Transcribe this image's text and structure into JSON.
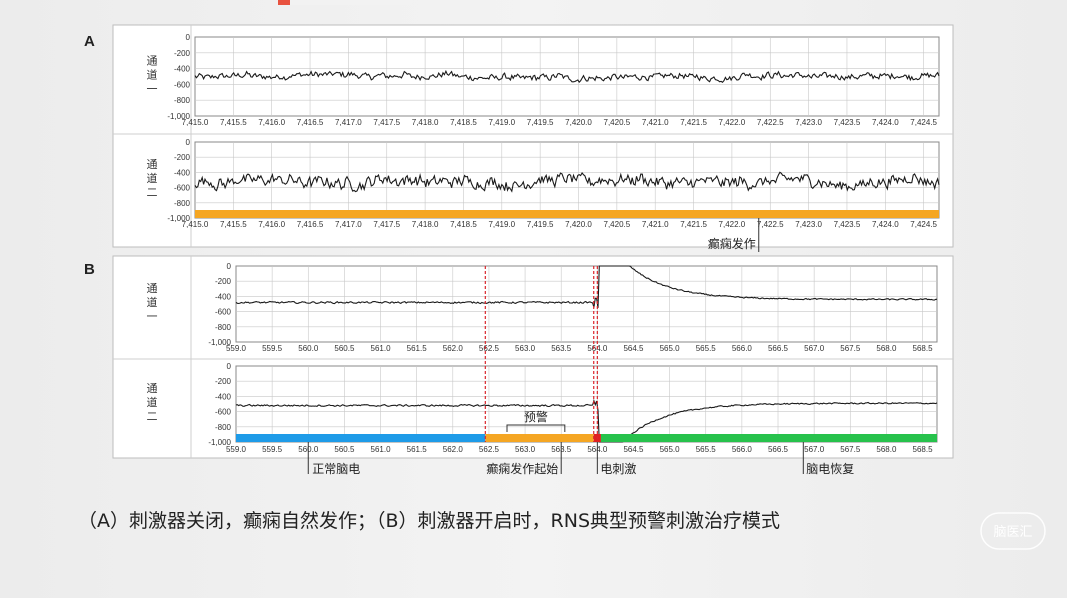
{
  "panels": {
    "A": {
      "letter": "A",
      "channels": [
        {
          "label_lines": [
            "通",
            "道",
            "一"
          ]
        },
        {
          "label_lines": [
            "通",
            "道",
            "二"
          ]
        }
      ],
      "y_ticks": [
        "0",
        "-200",
        "-400",
        "-600",
        "-800",
        "-1,000"
      ],
      "x_ticks": [
        "7,415.0",
        "7,415.5",
        "7,416.0",
        "7,416.5",
        "7,417.0",
        "7,417.5",
        "7,418.0",
        "7,418.5",
        "7,419.0",
        "7,419.5",
        "7,420.0",
        "7,420.5",
        "7,421.0",
        "7,421.5",
        "7,422.0",
        "7,422.5",
        "7,423.0",
        "7,423.5",
        "7,424.0",
        "7,424.5"
      ],
      "annotations": {
        "seizure": "癫痫发作"
      }
    },
    "B": {
      "letter": "B",
      "channels": [
        {
          "label_lines": [
            "通",
            "道",
            "一"
          ]
        },
        {
          "label_lines": [
            "通",
            "道",
            "二"
          ]
        }
      ],
      "y_ticks": [
        "0",
        "-200",
        "-400",
        "-600",
        "-800",
        "-1,000"
      ],
      "x_ticks": [
        "559.0",
        "559.5",
        "560.0",
        "560.5",
        "561.0",
        "561.5",
        "562.0",
        "562.5",
        "563.0",
        "563.5",
        "564.0",
        "564.5",
        "565.0",
        "565.5",
        "566.0",
        "566.5",
        "567.0",
        "567.5",
        "568.0",
        "568.5"
      ],
      "annotations": {
        "warning": "预警",
        "normal": "正常脑电",
        "onset": "癫痫发作起始",
        "stimulation": "电刺激",
        "recovery": "脑电恢复"
      }
    }
  },
  "caption": "（A）刺激器关闭，癫痫自然发作；（B）刺激器开启时，RNS典型预警刺激治疗模式",
  "logo_text": "脑医汇",
  "colors": {
    "trace": "#1a1a1a",
    "bar_orange": "#f5a623",
    "bar_blue": "#1e9be8",
    "bar_green": "#27c24c",
    "bar_red": "#e02020",
    "marker_red": "#d9262c",
    "grid": "#c8c8c8"
  },
  "chart_data": [
    {
      "type": "line",
      "panel": "A",
      "ylim": [
        -1000,
        0
      ],
      "xlim": [
        7415.0,
        7424.7
      ],
      "series": [
        {
          "channel": "通道一",
          "baseline": -500,
          "amplitude": 80
        },
        {
          "channel": "通道二",
          "baseline": -520,
          "amplitude": 150
        }
      ],
      "state_bar": [
        {
          "start": 7415.0,
          "end": 7424.7,
          "color": "orange"
        }
      ],
      "annotations": [
        {
          "text": "癫痫发作",
          "x": 7422.4
        }
      ]
    },
    {
      "type": "line",
      "panel": "B",
      "ylim": [
        -1000,
        0
      ],
      "xlim": [
        559.0,
        568.7
      ],
      "markers": [
        562.45,
        563.95,
        564.0
      ],
      "series": [
        {
          "channel": "通道一",
          "baseline": -480,
          "amplitude": 40,
          "after_stimulation": {
            "start": -5,
            "end": -440
          }
        },
        {
          "channel": "通道二",
          "baseline": -520,
          "amplitude": 40,
          "after_stimulation": {
            "start": -1000,
            "end": -490
          }
        }
      ],
      "state_bar": [
        {
          "start": 559.0,
          "end": 562.45,
          "color": "blue",
          "label": "正常脑电"
        },
        {
          "start": 562.45,
          "end": 563.95,
          "color": "orange",
          "label": "癫痫发作起始"
        },
        {
          "start": 563.95,
          "end": 564.05,
          "color": "red",
          "label": "电刺激"
        },
        {
          "start": 564.05,
          "end": 568.7,
          "color": "green",
          "label": "脑电恢复"
        }
      ],
      "annotations": [
        {
          "text": "预警",
          "x": 563.1
        },
        {
          "text": "正常脑电",
          "x": 560.5
        },
        {
          "text": "癫痫发作起始",
          "x": 563.3
        },
        {
          "text": "电刺激",
          "x": 564.3
        },
        {
          "text": "脑电恢复",
          "x": 566.7
        }
      ]
    }
  ]
}
